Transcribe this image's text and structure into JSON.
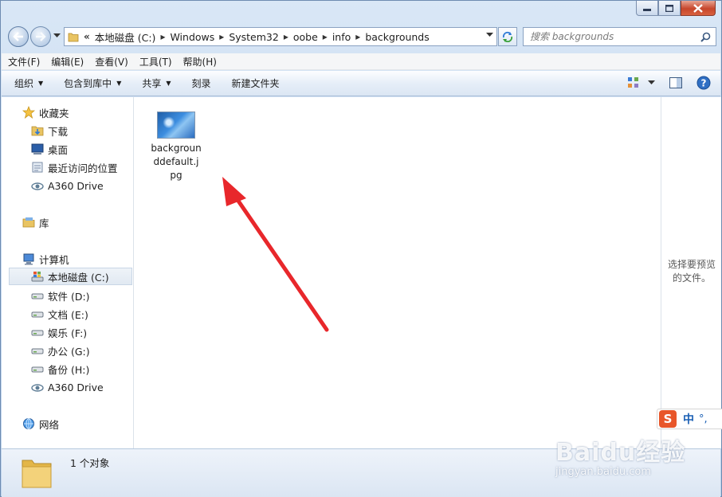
{
  "address": {
    "crumbs": [
      "本地磁盘 (C:)",
      "Windows",
      "System32",
      "oobe",
      "info",
      "backgrounds"
    ]
  },
  "search": {
    "placeholder": "搜索 backgrounds"
  },
  "menu": [
    "文件(F)",
    "编辑(E)",
    "查看(V)",
    "工具(T)",
    "帮助(H)"
  ],
  "toolbar": {
    "organize": "组织",
    "include_library": "包含到库中",
    "share": "共享",
    "burn": "刻录",
    "new_folder": "新建文件夹"
  },
  "nav": {
    "favorites": "收藏夹",
    "downloads": "下载",
    "desktop": "桌面",
    "recent": "最近访问的位置",
    "a360_fav": "A360 Drive",
    "libraries": "库",
    "computer": "计算机",
    "drive_c": "本地磁盘 (C:)",
    "drive_d": "软件 (D:)",
    "drive_e": "文档 (E:)",
    "drive_f": "娱乐 (F:)",
    "drive_g": "办公 (G:)",
    "drive_h": "备份 (H:)",
    "a360_comp": "A360 Drive",
    "network": "网络"
  },
  "files": [
    {
      "name": "backgrounddefault.jpg"
    }
  ],
  "preview": {
    "message": "选择要预览的文件。"
  },
  "status": {
    "count": "1 个对象"
  },
  "ime": {
    "logo": "S",
    "mode": "中",
    "punct": "°,"
  },
  "watermark": {
    "text": "Baidu经验",
    "url": "jingyan.baidu.com"
  },
  "colors": {
    "arrow": "#e8272b",
    "accent": "#1a5fb4"
  }
}
